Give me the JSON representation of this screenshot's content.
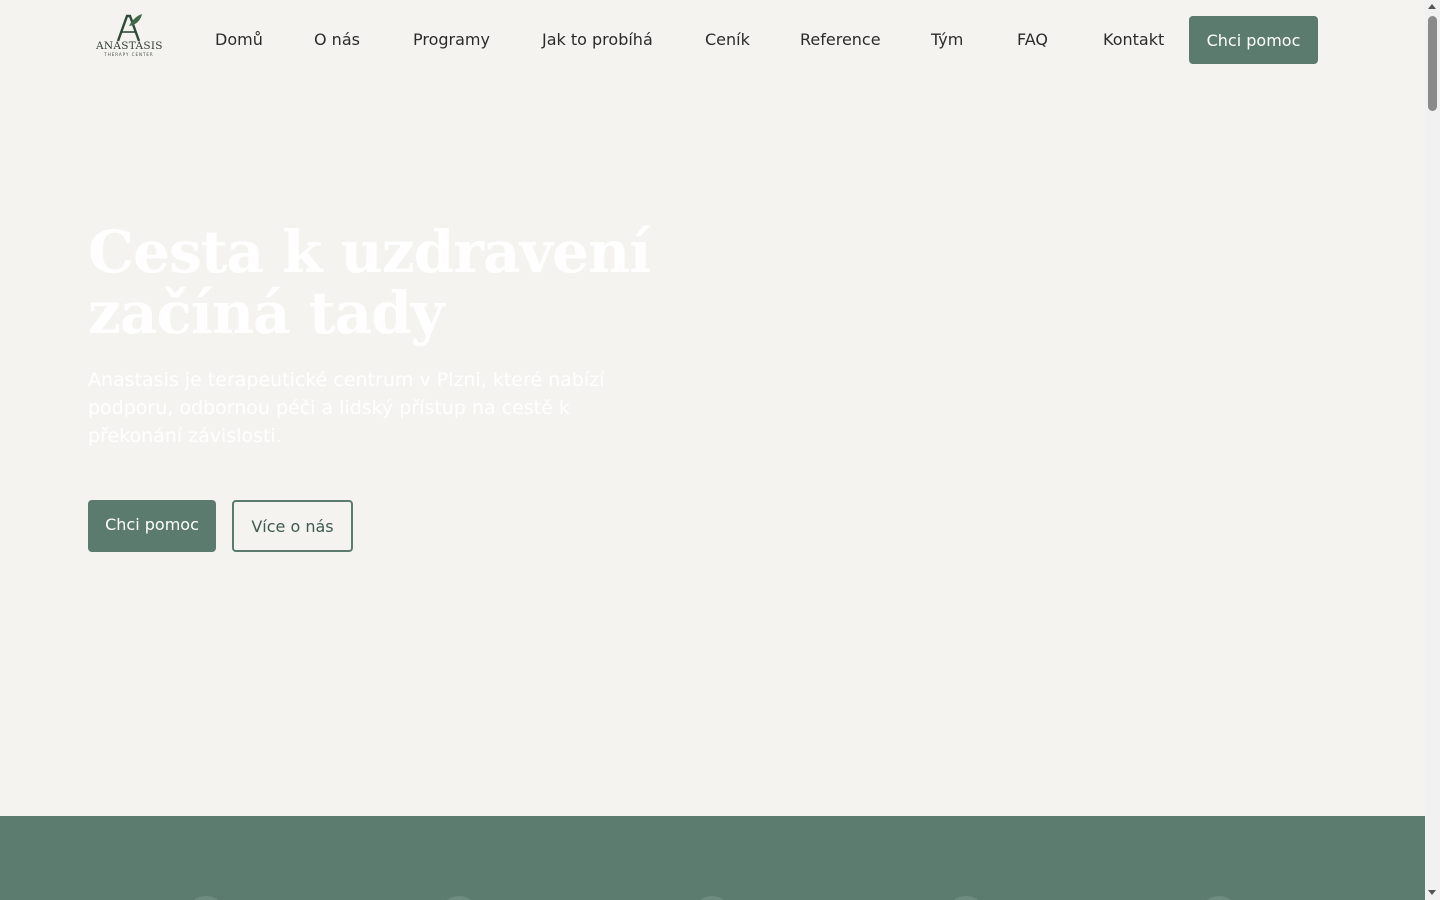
{
  "brand": {
    "logo_letter": "A",
    "name": "ANASTASIS",
    "tagline": "THERAPY CENTER",
    "primary_color": "#5b7b6e",
    "background_color": "#f4f3ef"
  },
  "nav": {
    "items": [
      {
        "label": "Domů"
      },
      {
        "label": "O nás"
      },
      {
        "label": "Programy"
      },
      {
        "label": "Jak to probíhá"
      },
      {
        "label": "Ceník"
      },
      {
        "label": "Reference"
      },
      {
        "label": "Tým"
      },
      {
        "label": "FAQ"
      },
      {
        "label": "Kontakt"
      }
    ],
    "cta_label": "Chci pomoc"
  },
  "hero": {
    "title_line1": "Cesta k uzdravení",
    "title_line2": "začíná tady",
    "text": "Anastasis je terapeutické centrum v Plzni, které nabízí podporu, odbornou péči a lidský přístup na cestě k překonání závislosti.",
    "primary_button": "Chci pomoc",
    "secondary_button": "Více o nás"
  }
}
